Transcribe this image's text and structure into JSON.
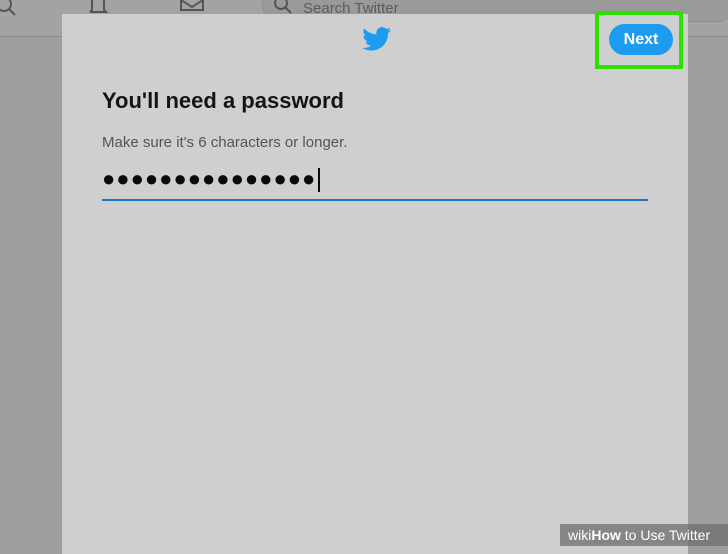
{
  "background": {
    "search_placeholder": "Search Twitter"
  },
  "modal": {
    "logo": "twitter-bird-icon",
    "next_label": "Next",
    "heading": "You'll need a password",
    "hint": "Make sure it's 6 characters or longer.",
    "password_masked": "●●●●●●●●●●●●●●●",
    "field_underline_color": "#1b74c8",
    "button_color": "#1d9bf0",
    "highlight_color": "#2de000"
  },
  "watermark": {
    "prefix": "wiki",
    "brand": "How",
    "text": " to Use Twitter"
  }
}
